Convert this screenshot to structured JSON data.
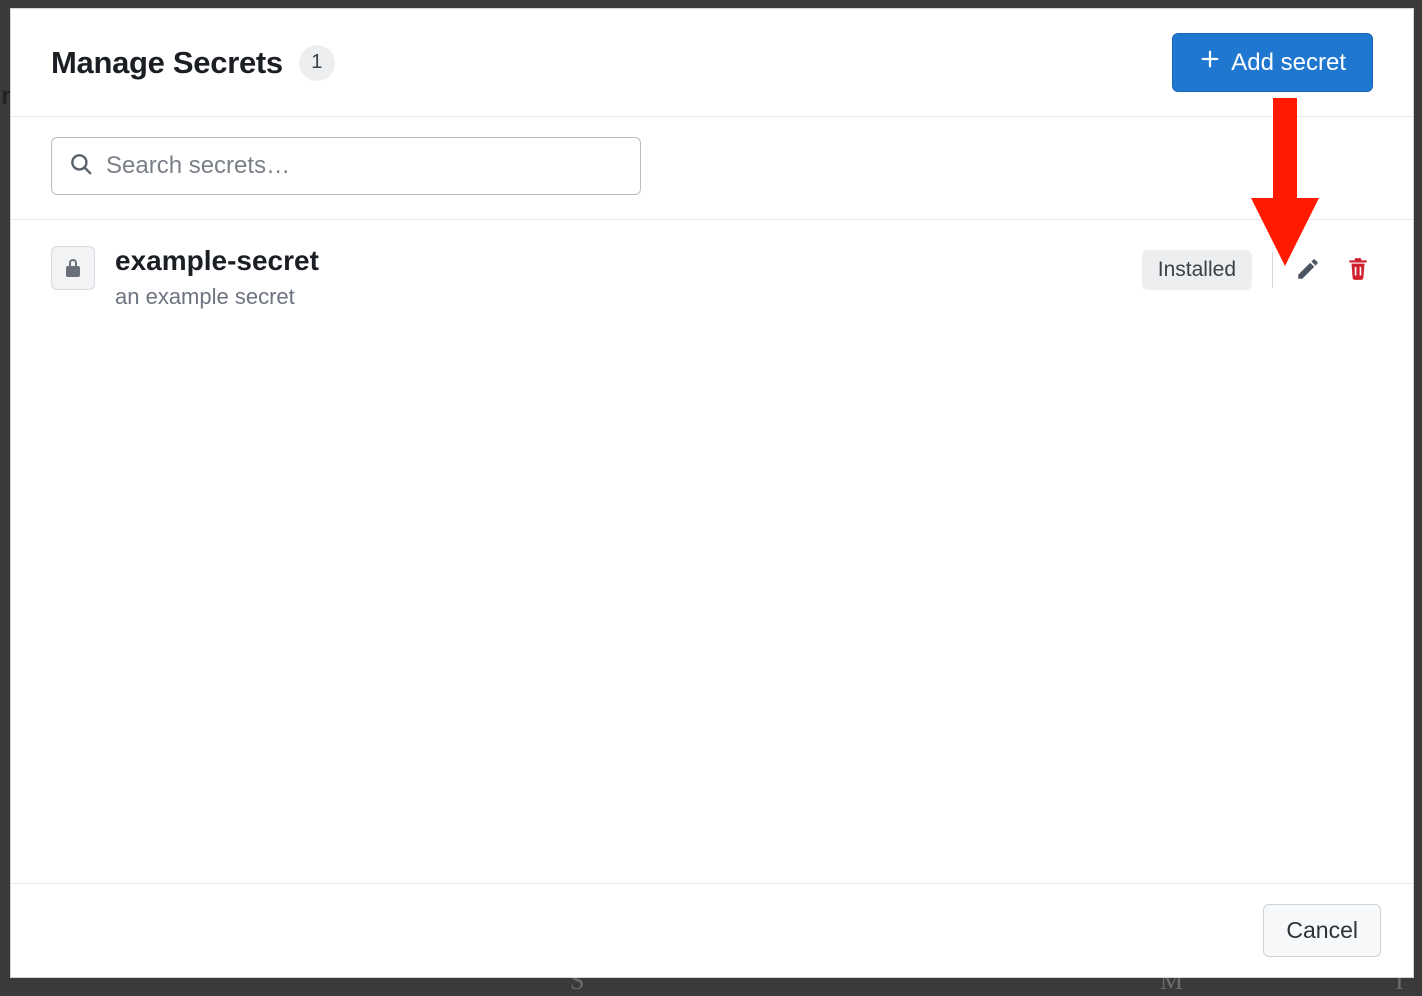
{
  "header": {
    "title": "Manage Secrets",
    "count": "1",
    "add_button_label": "Add secret"
  },
  "search": {
    "placeholder": "Search secrets…",
    "value": ""
  },
  "secrets": [
    {
      "name": "example-secret",
      "description": "an example secret",
      "status": "Installed"
    }
  ],
  "footer": {
    "cancel_label": "Cancel"
  },
  "colors": {
    "primary": "#1f77d0",
    "danger": "#cf222e",
    "muted_bg": "#eceef0",
    "border": "#e5e7eb",
    "annotation": "#ff1a00"
  }
}
